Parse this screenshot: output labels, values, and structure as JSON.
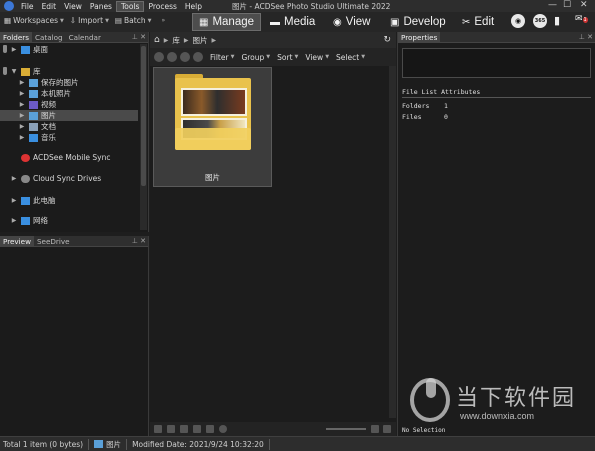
{
  "window": {
    "title": "图片 - ACDSee Photo Studio Ultimate 2022",
    "controls": [
      "—",
      "☐",
      "✕"
    ]
  },
  "menubar": {
    "items": [
      "File",
      "Edit",
      "View",
      "Panes",
      "Tools",
      "Process",
      "Help"
    ],
    "active": "Tools"
  },
  "toolbar": {
    "workspaces": "Workspaces",
    "import": "Import",
    "batch": "Batch",
    "modes": [
      "Manage",
      "Media",
      "View",
      "Develop",
      "Edit"
    ],
    "active_mode": "Manage",
    "round_icons": [
      "eye-icon",
      "365-icon",
      "chart-icon",
      "notification-icon"
    ],
    "notification_badge": "1"
  },
  "folders_panel": {
    "tabs": [
      "Folders",
      "Catalog",
      "Calendar"
    ],
    "active_tab": "Folders",
    "items": [
      {
        "label": "桌面",
        "level": 1,
        "icon": "desktop-icon"
      },
      {
        "label": "库",
        "level": 0,
        "icon": "library-icon"
      },
      {
        "label": "保存的图片",
        "level": 1,
        "icon": "saved-pictures-icon"
      },
      {
        "label": "本机照片",
        "level": 1,
        "icon": "camera-roll-icon"
      },
      {
        "label": "视频",
        "level": 1,
        "icon": "videos-icon"
      },
      {
        "label": "图片",
        "level": 1,
        "icon": "pictures-icon",
        "selected": true
      },
      {
        "label": "文档",
        "level": 1,
        "icon": "documents-icon"
      },
      {
        "label": "音乐",
        "level": 1,
        "icon": "music-icon"
      },
      {
        "label": "ACDSee Mobile Sync",
        "level": 0,
        "icon": "mobile-sync-icon"
      },
      {
        "label": "Cloud Sync Drives",
        "level": 0,
        "icon": "cloud-icon"
      },
      {
        "label": "此电脑",
        "level": 0,
        "icon": "computer-icon"
      },
      {
        "label": "网络",
        "level": 0,
        "icon": "network-icon"
      }
    ]
  },
  "preview_panel": {
    "tabs": [
      "Preview",
      "SeeDrive"
    ],
    "active_tab": "Preview"
  },
  "center": {
    "breadcrumb": [
      "库",
      "图片"
    ],
    "filters": [
      "Filter",
      "Group",
      "Sort",
      "View",
      "Select"
    ],
    "thumbnail_label": "图片"
  },
  "properties_panel": {
    "title": "Properties",
    "section": "File List Attributes",
    "attributes": [
      {
        "key": "Folders",
        "value": "1"
      },
      {
        "key": "Files",
        "value": "0"
      }
    ],
    "no_selection": "No Selection"
  },
  "watermark": {
    "text": "当下软件园",
    "url": "www.downxia.com"
  },
  "statusbar": {
    "total": "Total 1 item  (0 bytes)",
    "folder": "图片",
    "modified": "Modified Date: 2021/9/24 10:32:20"
  },
  "colors": {
    "accent": "#3c78d8",
    "folder": "#e9c24c",
    "selection": "#4a4a4a"
  }
}
